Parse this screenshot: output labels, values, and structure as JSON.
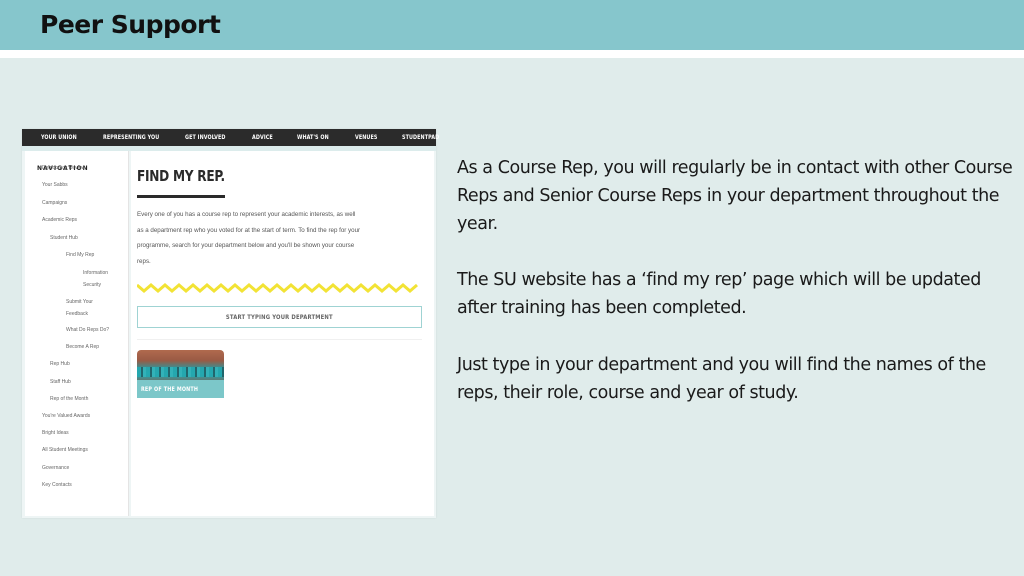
{
  "slide": {
    "title": "Peer Support",
    "paragraphs": [
      "As a Course Rep, you will regularly be in contact with other Course Reps and Senior Course Reps in your department throughout the year.",
      "The SU website has a ‘find my rep’ page which will be updated after training has been completed.",
      "Just type in your department and you will find the names of the reps, their role, course and year of study."
    ]
  },
  "website": {
    "topnav": [
      "YOUR UNION",
      "REPRESENTING YOU",
      "GET INVOLVED",
      "ADVICE",
      "WHAT'S ON",
      "VENUES",
      "STUDENTPAD"
    ],
    "sidebar": {
      "heading": "NAVIGATION",
      "items": [
        {
          "label": "Democracy Review",
          "level": 0
        },
        {
          "label": "Your Sabbs",
          "level": 0
        },
        {
          "label": "Campaigns",
          "level": 0
        },
        {
          "label": "Academic Reps",
          "level": 0
        },
        {
          "label": "Student Hub",
          "level": 1
        },
        {
          "label": "Find My Rep",
          "level": 2
        },
        {
          "label": "Information",
          "level": 3
        },
        {
          "label": "Security",
          "level": 3
        },
        {
          "label": "Submit Your",
          "level": 2
        },
        {
          "label": "Feedback",
          "level": 2
        },
        {
          "label": "What Do Reps Do?",
          "level": 2
        },
        {
          "label": "Become A Rep",
          "level": 2
        },
        {
          "label": "Rep Hub",
          "level": 1
        },
        {
          "label": "Staff Hub",
          "level": 1
        },
        {
          "label": "Rep of the Month",
          "level": 1
        },
        {
          "label": "You're Valued Awards",
          "level": 0
        },
        {
          "label": "Bright Ideas",
          "level": 0
        },
        {
          "label": "All Student Meetings",
          "level": 0
        },
        {
          "label": "Governance",
          "level": 0
        },
        {
          "label": "Key Contacts",
          "level": 0
        }
      ]
    },
    "main": {
      "heading": "FIND MY REP.",
      "intro_lines": [
        "Every one of you has a course rep to represent your academic interests, as well",
        "as a department rep who you voted for at the start of term. To find the rep for your",
        "programme, search for your department below and you'll be shown your course",
        "reps."
      ],
      "search_placeholder": "START TYPING YOUR DEPARTMENT",
      "rep_card_label": "REP OF THE MONTH"
    }
  },
  "colors": {
    "title_bar": "#86c6cc",
    "slide_bg": "#e0eceb",
    "nav_bar": "#2b2b2b",
    "zigzag": "#f2e335",
    "accent_teal": "#7cc7c9"
  }
}
